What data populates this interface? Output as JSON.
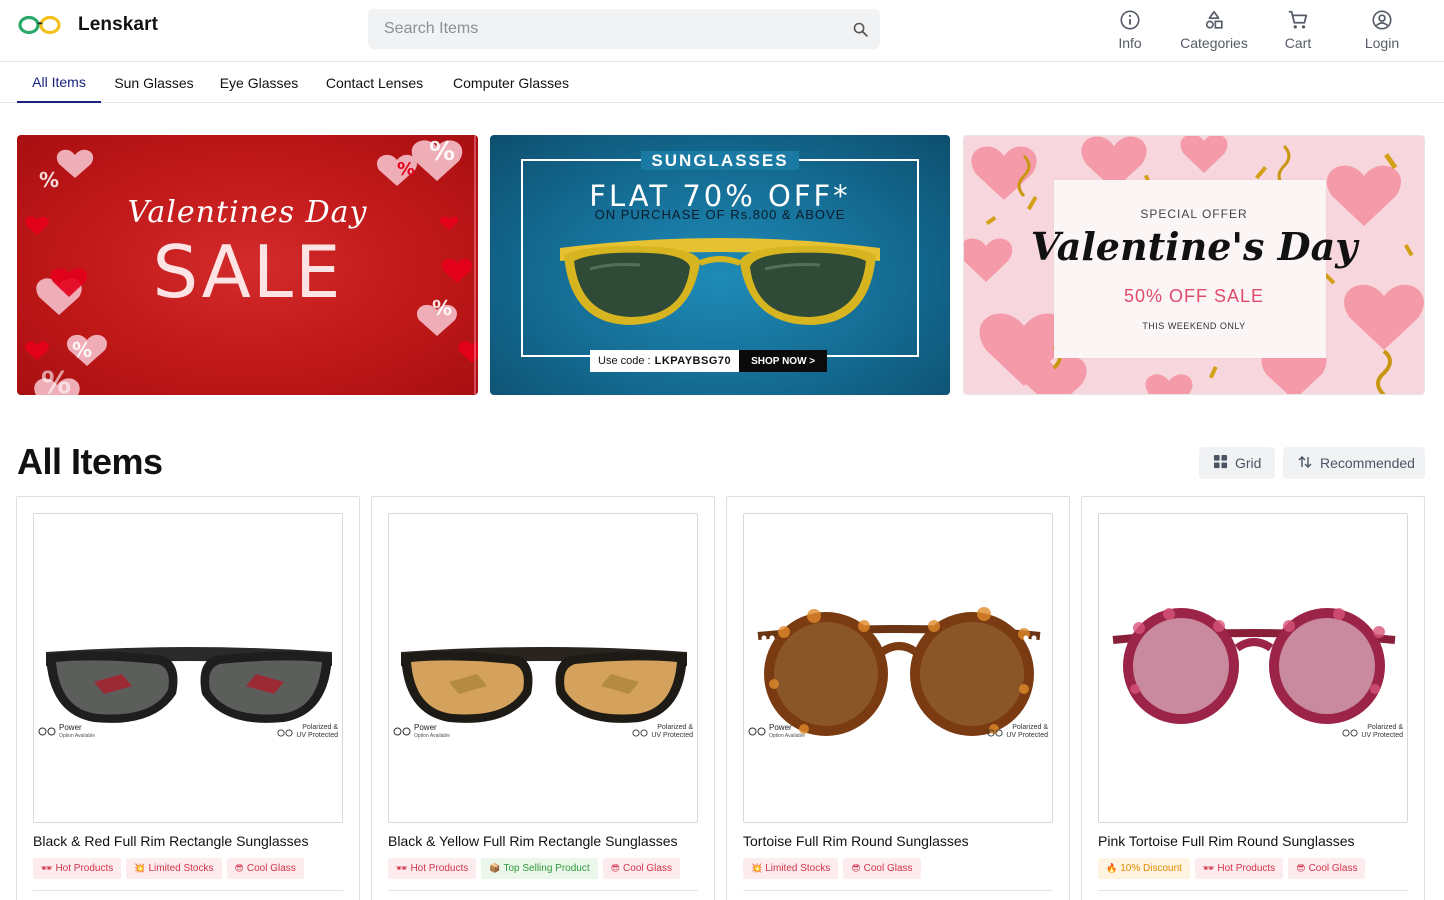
{
  "header": {
    "brand": "Lenskart",
    "search_placeholder": "Search Items",
    "actions": [
      {
        "label": "Info",
        "icon": "info-icon"
      },
      {
        "label": "Categories",
        "icon": "categories-icon"
      },
      {
        "label": "Cart",
        "icon": "cart-icon"
      },
      {
        "label": "Login",
        "icon": "account-icon"
      }
    ]
  },
  "tabs": [
    {
      "label": "All Items",
      "active": true
    },
    {
      "label": "Sun Glasses",
      "active": false
    },
    {
      "label": "Eye Glasses",
      "active": false
    },
    {
      "label": "Contact Lenses",
      "active": false
    },
    {
      "label": "Computer Glasses",
      "active": false
    }
  ],
  "banners": {
    "b1": {
      "script": "Valentines Day",
      "sale": "SALE"
    },
    "b2": {
      "title": "SUNGLASSES",
      "offer": "FLAT 70% OFF*",
      "condition": "ON PURCHASE OF Rs.800 & ABOVE",
      "code_label": "Use code :",
      "code": "LKPAYBSG70",
      "cta": "SHOP NOW >"
    },
    "b3": {
      "special": "SPECIAL OFFER",
      "script": "Valentine's Day",
      "offer": "50% OFF SALE",
      "note": "THIS WEEKEND ONLY"
    }
  },
  "section": {
    "title": "All Items",
    "grid_label": "Grid",
    "sort_label": "Recommended"
  },
  "products": [
    {
      "name": "Black & Red Full Rim Rectangle Sunglasses",
      "power_label": "Power",
      "power_sub": "Option Available",
      "polar_line1": "Polarized &",
      "polar_line2": "UV Protected",
      "tags": [
        {
          "emoji": "🕶",
          "text": "Hot Products",
          "style": "red"
        },
        {
          "emoji": "💥",
          "text": "Limited Stocks",
          "style": "red"
        },
        {
          "emoji": "😎",
          "text": "Cool Glass",
          "style": "red"
        }
      ]
    },
    {
      "name": "Black & Yellow Full Rim Rectangle Sunglasses",
      "power_label": "Power",
      "power_sub": "Option Available",
      "polar_line1": "Polarized &",
      "polar_line2": "UV Protected",
      "tags": [
        {
          "emoji": "🕶",
          "text": "Hot Products",
          "style": "red"
        },
        {
          "emoji": "📦",
          "text": "Top Selling Product",
          "style": "green"
        },
        {
          "emoji": "😎",
          "text": "Cool Glass",
          "style": "red"
        }
      ]
    },
    {
      "name": "Tortoise Full Rim Round Sunglasses",
      "power_label": "Power",
      "power_sub": "Option Available",
      "polar_line1": "Polarized &",
      "polar_line2": "UV Protected",
      "tags": [
        {
          "emoji": "💥",
          "text": "Limited Stocks",
          "style": "red"
        },
        {
          "emoji": "😎",
          "text": "Cool Glass",
          "style": "red"
        }
      ]
    },
    {
      "name": "Pink Tortoise Full Rim Round Sunglasses",
      "power_label": "",
      "power_sub": "",
      "polar_line1": "Polarized &",
      "polar_line2": "UV Protected",
      "tags": [
        {
          "emoji": "🔥",
          "text": "10% Discount",
          "style": "amber"
        },
        {
          "emoji": "🕶",
          "text": "Hot Products",
          "style": "red"
        },
        {
          "emoji": "😎",
          "text": "Cool Glass",
          "style": "red"
        }
      ]
    }
  ],
  "colors": {
    "accent": "#1a237e",
    "banner_red": "#c01818",
    "banner_blue": "#13688e",
    "banner_pink": "#f7d7dd"
  }
}
